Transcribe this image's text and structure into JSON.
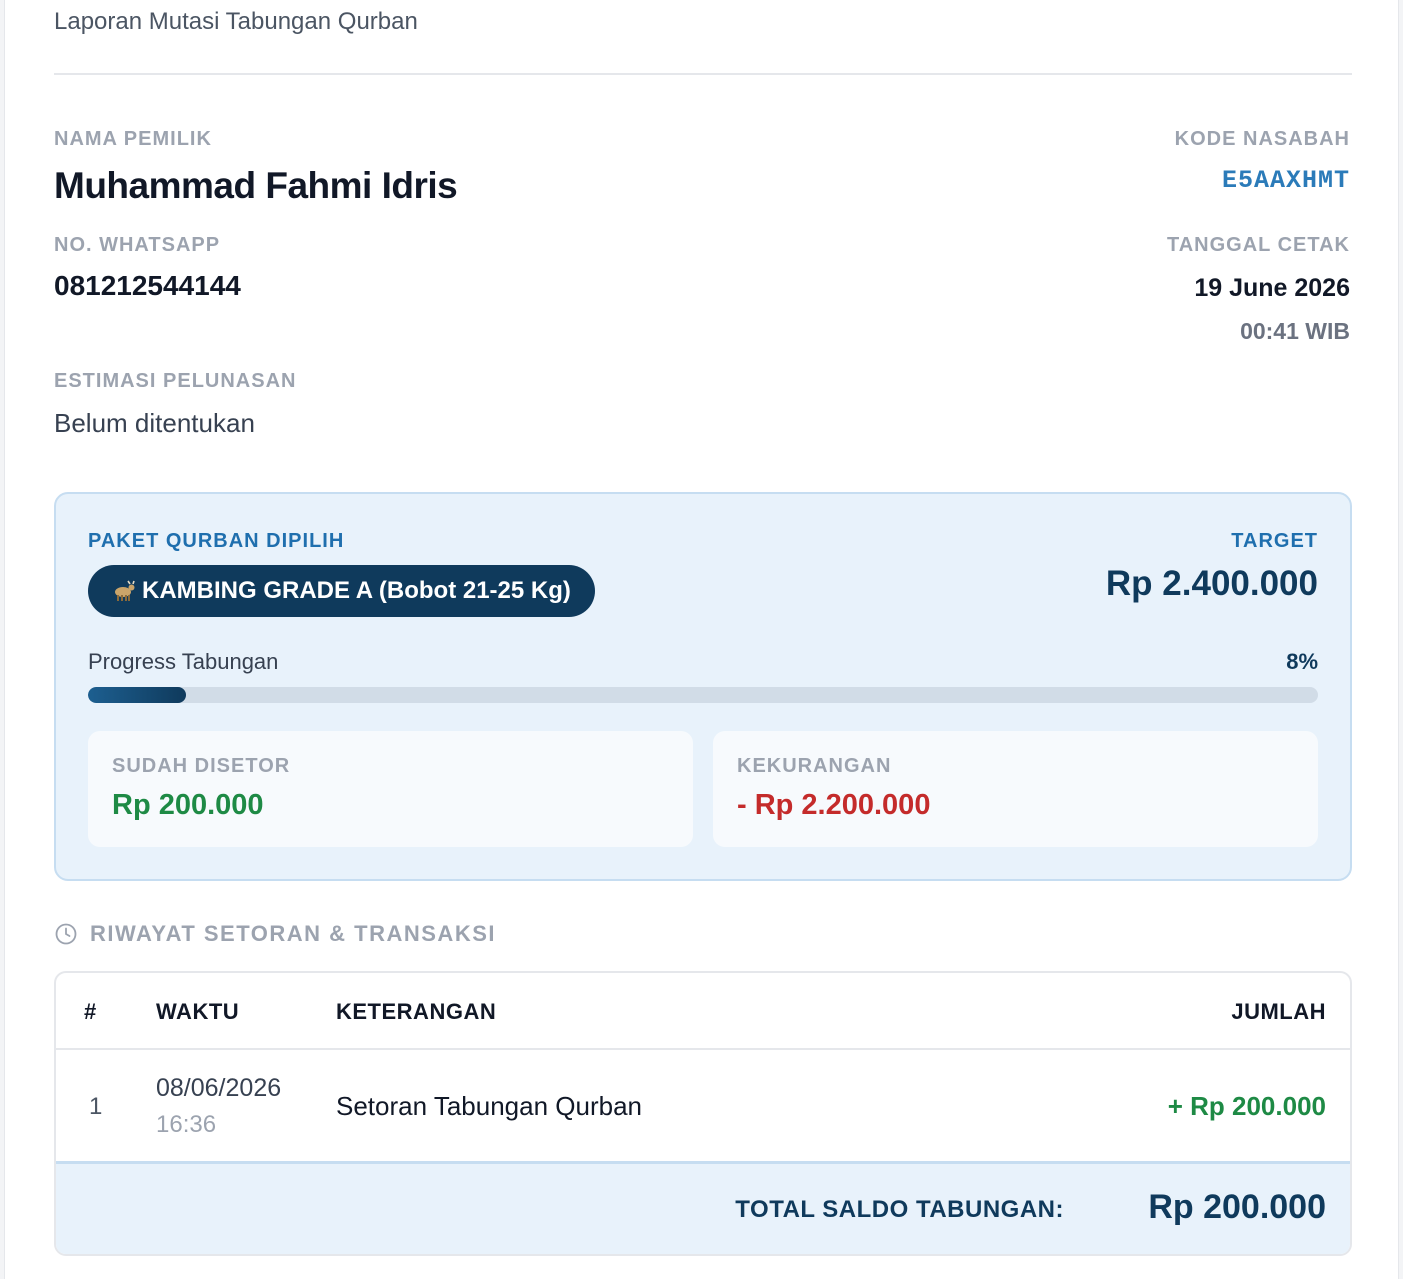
{
  "header": {
    "title": "Laporan Mutasi Tabungan Qurban"
  },
  "owner": {
    "name_label": "NAMA PEMILIK",
    "name": "Muhammad Fahmi Idris",
    "whatsapp_label": "NO. WHATSAPP",
    "whatsapp": "081212544144",
    "estimate_label": "ESTIMASI PELUNASAN",
    "estimate": "Belum ditentukan"
  },
  "meta": {
    "code_label": "KODE NASABAH",
    "code": "E5AAXHMT",
    "print_date_label": "TANGGAL CETAK",
    "print_date": "19 June 2026",
    "print_time": "00:41 WIB"
  },
  "package": {
    "label": "PAKET QURBAN DIPILIH",
    "icon": "goat-icon",
    "name": "KAMBING GRADE A (Bobot 21-25 Kg)",
    "target_label": "TARGET",
    "target": "Rp 2.400.000",
    "progress_label": "Progress Tabungan",
    "progress_text": "8%",
    "progress_fraction": 0.08,
    "paid_label": "SUDAH DISETOR",
    "paid": "Rp 200.000",
    "shortfall_label": "KEKURANGAN",
    "shortfall": "- Rp 2.200.000"
  },
  "history": {
    "title": "RIWAYAT SETORAN & TRANSAKSI",
    "columns": {
      "num": "#",
      "time": "WAKTU",
      "desc": "KETERANGAN",
      "amount": "JUMLAH"
    },
    "rows": [
      {
        "num": "1",
        "date": "08/06/2026",
        "time": "16:36",
        "desc": "Setoran Tabungan Qurban",
        "amount": "+ Rp 200.000"
      }
    ],
    "total_label": "TOTAL SALDO TABUNGAN:",
    "total": "Rp 200.000"
  },
  "colors": {
    "accent": "#0f3a5c",
    "positive": "#1e8a45",
    "negative": "#c42b2b",
    "code": "#2b7bb9"
  }
}
